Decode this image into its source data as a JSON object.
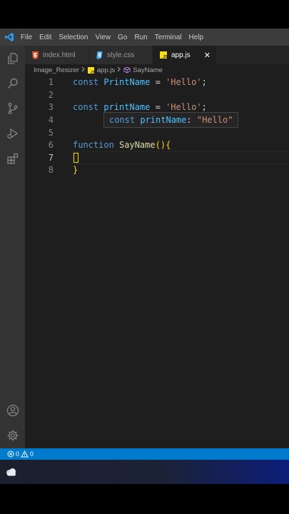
{
  "menu": [
    "File",
    "Edit",
    "Selection",
    "View",
    "Go",
    "Run",
    "Terminal",
    "Help"
  ],
  "tabs": [
    {
      "label": "index.html",
      "icon": "html5-icon",
      "color": "#e34c26"
    },
    {
      "label": "style.css",
      "icon": "css3-icon",
      "color": "#42a5f5"
    },
    {
      "label": "app.js",
      "icon": "javascript-icon",
      "color": "#f5de19",
      "active": true,
      "close": "✕"
    }
  ],
  "breadcrumb": {
    "folder": "Image_Resizer",
    "file": "app.js",
    "symbol": "SayName"
  },
  "editor": {
    "line_numbers": [
      "1",
      "2",
      "3",
      "4",
      "5",
      "6",
      "7",
      "8"
    ],
    "current_line": 7,
    "line1": {
      "kw": "const",
      "name": "PrintName",
      "eq": " = ",
      "str": "'Hello'",
      "end": ";"
    },
    "line3": {
      "kw": "const",
      "name": "printName",
      "eq": " = ",
      "str": "'Hello'",
      "end": ";"
    },
    "line6": {
      "kw": "function",
      "name": "SayName",
      "paren": "()",
      "brace": "{"
    },
    "line8": {
      "brace": "}"
    }
  },
  "hover": {
    "kw": "const",
    "name": "printName",
    "colon": ": ",
    "value": "\"Hello\""
  },
  "status": {
    "errors": "0",
    "warnings": "0"
  },
  "colors": {
    "accent": "#007acc",
    "titlebar": "#3c3c3c",
    "editor_bg": "#1e1e1e"
  }
}
